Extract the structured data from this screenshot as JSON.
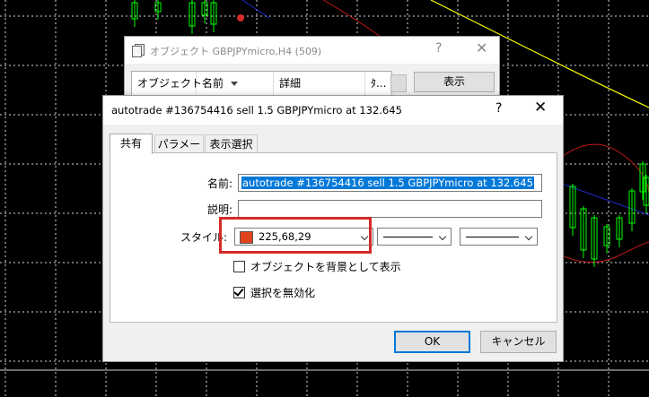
{
  "back_window": {
    "title": "オブジェクト GBPJPYmicro,H4 (509)",
    "help": "?",
    "close": "✕",
    "columns": [
      "オブジェクト",
      "名前",
      "詳細",
      "ﾀ..."
    ],
    "show_button": "表示"
  },
  "dialog": {
    "title": "autotrade #136754416 sell 1.5 GBPJPYmicro at 132.645",
    "help": "?",
    "close": "✕",
    "tabs": [
      "共有",
      "パラメータ",
      "表示選択"
    ],
    "name_label": "名前:",
    "name_value": "autotrade #136754416 sell 1.5 GBPJPYmicro at 132.645",
    "desc_label": "説明:",
    "desc_value": "",
    "style_label": "スタイル:",
    "color_value": "225,68,29",
    "color_hex": "#e1441d",
    "checkbox_background": "オブジェクトを背景として表示",
    "checkbox_background_checked": false,
    "checkbox_disable_select": "選択を無効化",
    "checkbox_disable_select_checked": true,
    "ok": "OK",
    "cancel": "キャンセル"
  },
  "colors": {
    "chart_bg": "#000000",
    "bull_candle": "#00ff00",
    "grid": "#d8d8d8",
    "yellow_line": "#ffff00",
    "red_band": "#c01818",
    "blue_line": "#1a2fd0",
    "highlight": "#d42a2a"
  }
}
